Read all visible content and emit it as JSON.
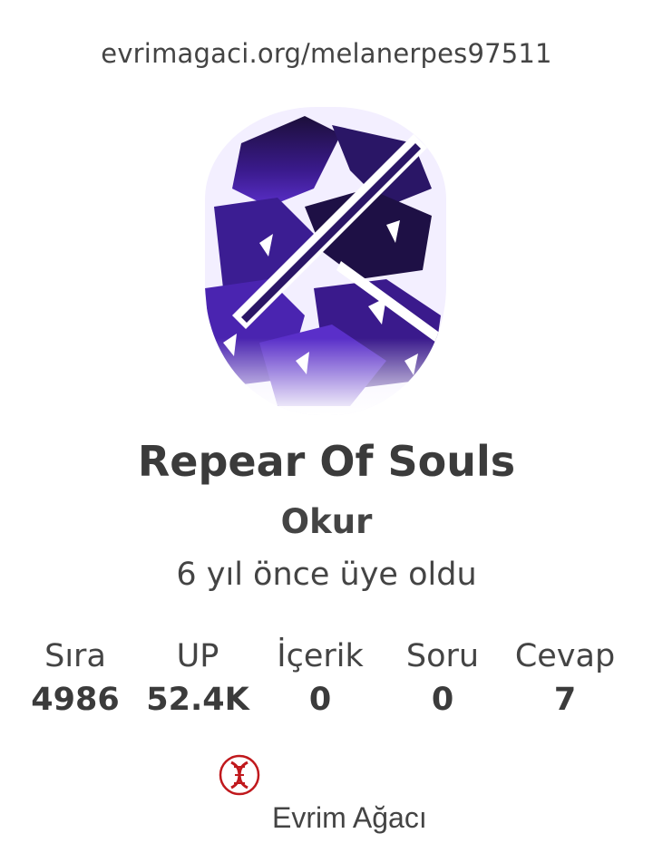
{
  "profile": {
    "url": "evrimagaci.org/melanerpes97511",
    "username": "Repear Of Souls",
    "role": "Okur",
    "joined": "6 yıl önce üye oldu",
    "avatar_icon": "warrior-avatar-icon"
  },
  "stats": [
    {
      "label": "Sıra",
      "value": "4986"
    },
    {
      "label": "UP",
      "value": "52.4K"
    },
    {
      "label": "İçerik",
      "value": "0"
    },
    {
      "label": "Soru",
      "value": "0"
    },
    {
      "label": "Cevap",
      "value": "7"
    }
  ],
  "footer": {
    "brand": "Evrim Ağacı",
    "logo_icon": "dna-logo-icon",
    "logo_color": "#c0181c"
  },
  "colors": {
    "text": "#3b3b3b",
    "avatar_purple": "#3a1a8c"
  }
}
